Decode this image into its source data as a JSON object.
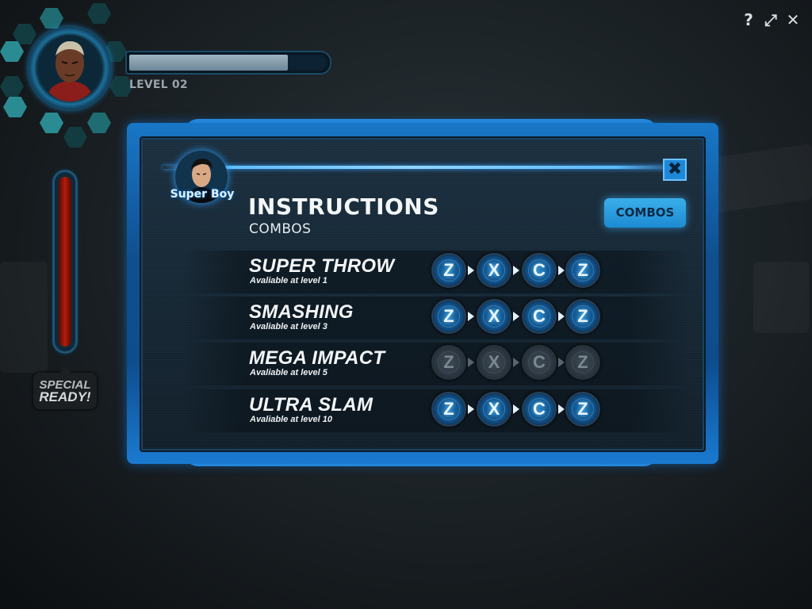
{
  "window_controls": {
    "help": "?",
    "fullscreen": "⤢",
    "close": "✕"
  },
  "player": {
    "level_label": "LEVEL 02",
    "health_fraction": 0.8,
    "special_fraction": 1.0,
    "special_label_line1": "SPECIAL",
    "special_label_line2": "READY!"
  },
  "dialog": {
    "character_name": "Super Boy",
    "title": "INSTRUCTIONS",
    "subtitle": "COMBOS",
    "combos_button": "COMBOS",
    "close_icon": "✖",
    "combos": [
      {
        "name": "SUPER THROW",
        "availability": "Avaliable at level 1",
        "keys": [
          "Z",
          "X",
          "C",
          "Z"
        ],
        "locked": false
      },
      {
        "name": "SMASHING",
        "availability": "Avaliable at level 3",
        "keys": [
          "Z",
          "X",
          "C",
          "Z"
        ],
        "locked": false
      },
      {
        "name": "MEGA IMPACT",
        "availability": "Avaliable at level 5",
        "keys": [
          "Z",
          "X",
          "C",
          "Z"
        ],
        "locked": true
      },
      {
        "name": "ULTRA SLAM",
        "availability": "Avaliable at level 10",
        "keys": [
          "Z",
          "X",
          "C",
          "Z"
        ],
        "locked": false
      }
    ]
  },
  "colors": {
    "panel_blue": "#1877c7",
    "button_blue": "#3aaee9",
    "special_red": "#b31c0c"
  }
}
